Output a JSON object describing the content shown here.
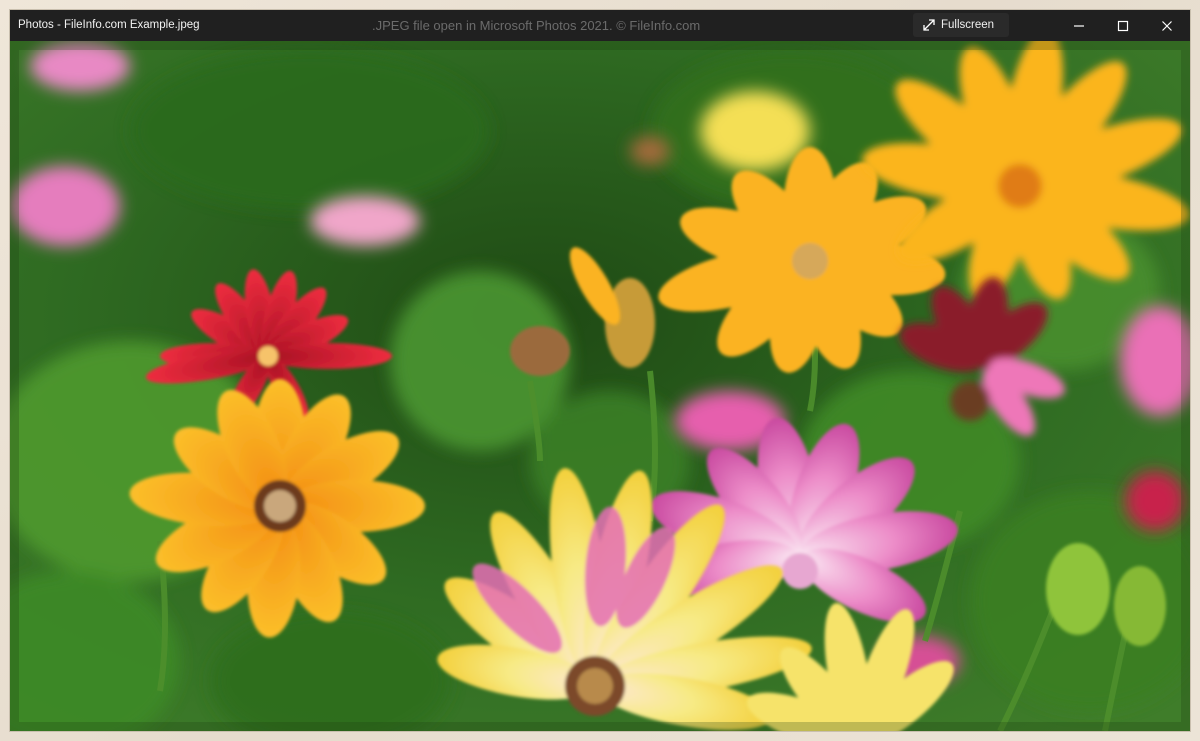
{
  "window": {
    "app_title": "Photos - FileInfo.com Example.jpeg",
    "watermark": ".JPEG file open in Microsoft Photos 2021. © FileInfo.com",
    "fullscreen_label": "Fullscreen",
    "icons": {
      "fullscreen": "expand-arrows-icon",
      "minimize": "minimize-icon",
      "maximize": "maximize-icon",
      "close": "close-icon"
    }
  },
  "photo": {
    "subject": "flowers-photo",
    "colors": {
      "background_green": "#2f6b22",
      "yellow": "#f7b21a",
      "orange": "#f49a16",
      "red": "#e0283a",
      "pink": "#e46fb6",
      "light_yellow": "#f6e36a"
    }
  }
}
